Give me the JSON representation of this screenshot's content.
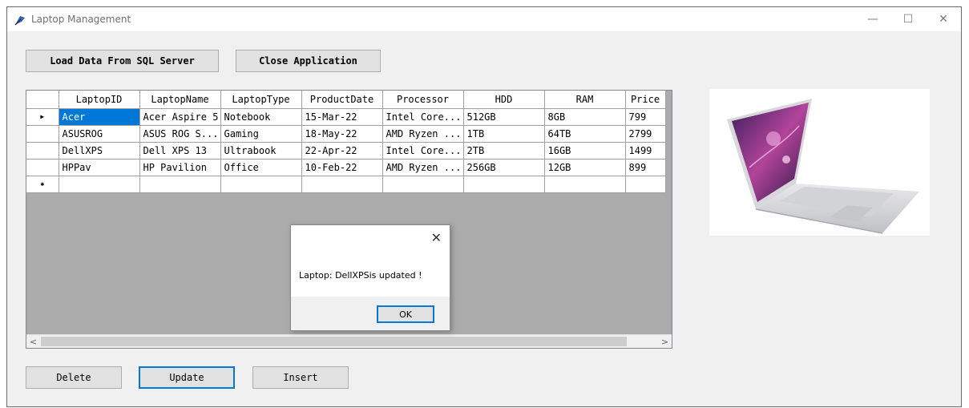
{
  "window": {
    "title": "Laptop Management",
    "controls": {
      "minimize": "—",
      "maximize": "☐",
      "close": "✕"
    }
  },
  "toolbar": {
    "load_label": "Load Data From SQL Server",
    "close_label": "Close Application"
  },
  "grid": {
    "columns": [
      "LaptopID",
      "LaptopName",
      "LaptopType",
      "ProductDate",
      "Processor",
      "HDD",
      "RAM",
      "Price"
    ],
    "rows": [
      [
        "Acer",
        "Acer Aspire 5",
        "Notebook",
        "15-Mar-22",
        "Intel Core...",
        "512GB",
        "8GB",
        "799"
      ],
      [
        "ASUSROG",
        "ASUS ROG S...",
        "Gaming",
        "18-May-22",
        "AMD Ryzen ...",
        "1TB",
        "64TB",
        "2799"
      ],
      [
        "DellXPS",
        "Dell XPS 13",
        "Ultrabook",
        "22-Apr-22",
        "Intel Core...",
        "2TB",
        "16GB",
        "1499"
      ],
      [
        "HPPav",
        "HP Pavilion",
        "Office",
        "10-Feb-22",
        "AMD Ryzen ...",
        "256GB",
        "12GB",
        "899"
      ]
    ],
    "current_row_marker": "▶",
    "new_row_marker": "✱",
    "scroll_left": "<",
    "scroll_right": ">"
  },
  "dialog": {
    "message": "Laptop: DellXPSis updated !",
    "ok_label": "OK",
    "close_glyph": "✕"
  },
  "actions": {
    "delete_label": "Delete",
    "update_label": "Update",
    "insert_label": "Insert"
  },
  "colors": {
    "accent": "#0078d7",
    "grid_background": "#ababab",
    "window_background": "#f0f0f0"
  },
  "icons": {
    "app": "feather-icon",
    "picture": "laptop-photo"
  }
}
